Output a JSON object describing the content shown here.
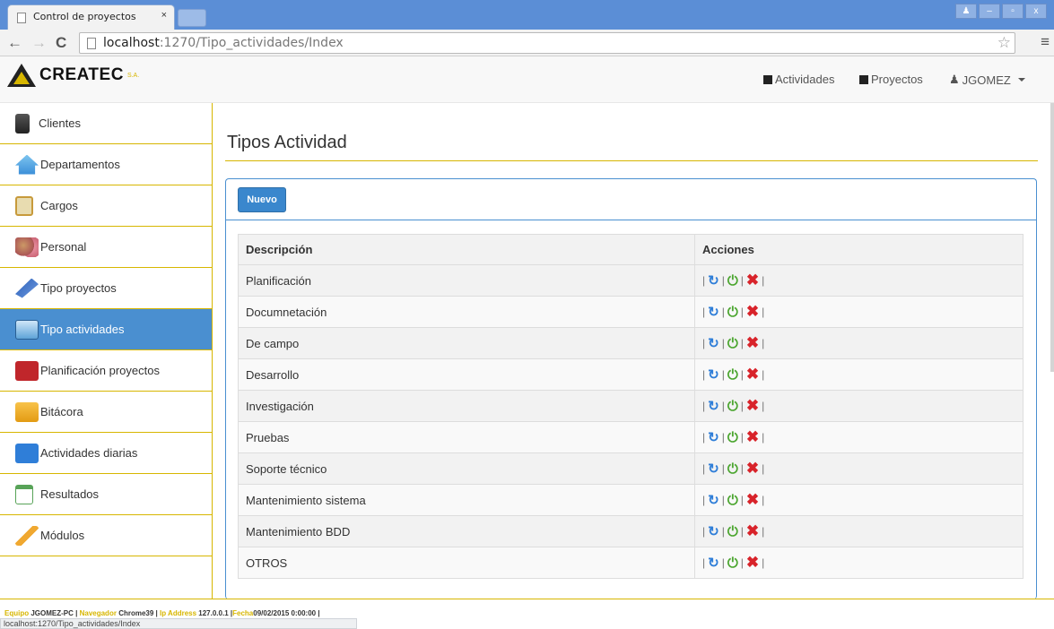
{
  "browser": {
    "tab_title": "Control de proyectos",
    "tab_close": "×",
    "url_host": "localhost",
    "url_path": ":1270/Tipo_actividades/Index",
    "status_url": "localhost:1270/Tipo_actividades/Index"
  },
  "header": {
    "logo_text": "CREATEC",
    "logo_sub": "S.A.",
    "nav": {
      "actividades": "Actividades",
      "proyectos": "Proyectos",
      "user": "JGOMEZ"
    }
  },
  "sidebar": {
    "items": [
      {
        "label": "Clientes",
        "icon": "client-icon"
      },
      {
        "label": "Departamentos",
        "icon": "house-icon"
      },
      {
        "label": "Cargos",
        "icon": "clipboard-icon"
      },
      {
        "label": "Personal",
        "icon": "people-icon"
      },
      {
        "label": "Tipo proyectos",
        "icon": "pen-icon"
      },
      {
        "label": "Tipo actividades",
        "icon": "window-icon"
      },
      {
        "label": "Planificación proyectos",
        "icon": "toolbox-icon"
      },
      {
        "label": "Bitácora",
        "icon": "folder-icon"
      },
      {
        "label": "Actividades diarias",
        "icon": "people-board-icon"
      },
      {
        "label": "Resultados",
        "icon": "spreadsheet-icon"
      },
      {
        "label": "Módulos",
        "icon": "pencil-icon"
      }
    ],
    "active_index": 5
  },
  "main": {
    "title": "Tipos Actividad",
    "new_button": "Nuevo",
    "table": {
      "headers": [
        "Descripción",
        "Acciones"
      ],
      "rows": [
        "Planificación",
        "Documnetación",
        "De campo",
        "Desarrollo",
        "Investigación",
        "Pruebas",
        "Soporte técnico",
        "Mantenimiento sistema",
        "Mantenimiento BDD",
        "OTROS"
      ]
    }
  },
  "footer": {
    "equipo_label": "Equipo",
    "equipo_value": "JGOMEZ-PC",
    "navegador_label": "Navegador",
    "navegador_value": "Chrome39",
    "ip_label": "Ip Address",
    "ip_value": "127.0.0.1",
    "fecha_label": "Fecha",
    "fecha_value": "09/02/2015 0:00:00"
  },
  "colors": {
    "accent": "#d7b600",
    "active_bg": "#4a8fd0",
    "button_primary": "#3a87cd"
  }
}
